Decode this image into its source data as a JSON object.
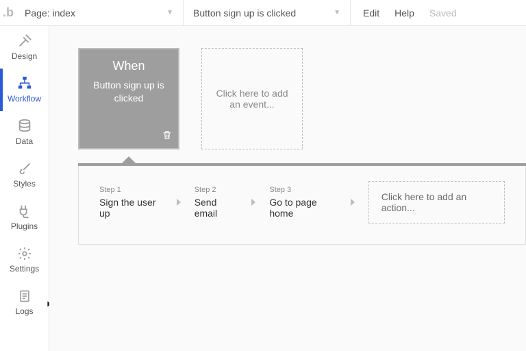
{
  "topbar": {
    "page_dropdown_label": "Page: index",
    "event_dropdown_label": "Button sign up is clicked",
    "edit": "Edit",
    "help": "Help",
    "saved": "Saved"
  },
  "sidebar": {
    "items": [
      {
        "label": "Design"
      },
      {
        "label": "Workflow"
      },
      {
        "label": "Data"
      },
      {
        "label": "Styles"
      },
      {
        "label": "Plugins"
      },
      {
        "label": "Settings"
      },
      {
        "label": "Logs"
      }
    ],
    "active_index": 1
  },
  "workflow": {
    "selected_event": {
      "when_label": "When",
      "description": "Button sign up is clicked"
    },
    "add_event_placeholder": "Click here to add an event...",
    "steps": [
      {
        "num": "Step 1",
        "label": "Sign the user up"
      },
      {
        "num": "Step 2",
        "label": "Send email"
      },
      {
        "num": "Step 3",
        "label": "Go to page home"
      }
    ],
    "add_action_placeholder": "Click here to add an action..."
  }
}
